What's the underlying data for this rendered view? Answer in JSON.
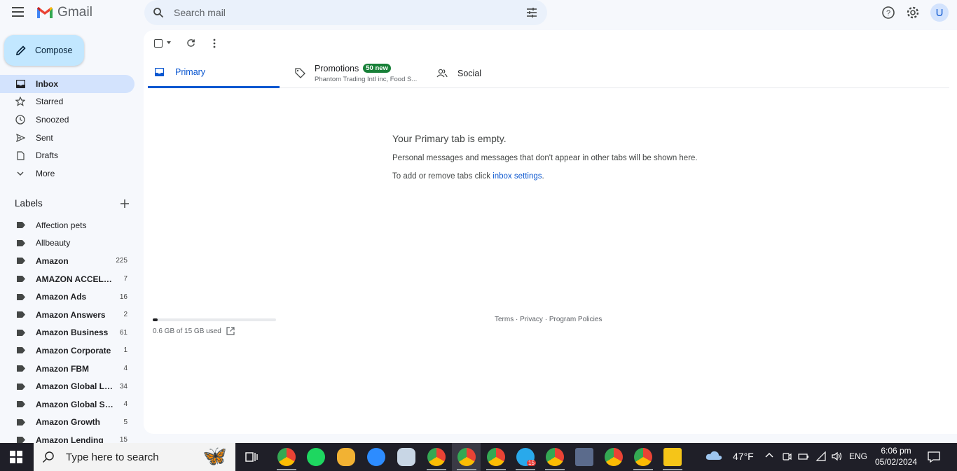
{
  "header": {
    "app_name": "Gmail",
    "search_placeholder": "Search mail",
    "avatar_initial": "U"
  },
  "sidebar": {
    "compose_label": "Compose",
    "items": [
      {
        "label": "Inbox",
        "icon": "inbox-icon",
        "active": true
      },
      {
        "label": "Starred",
        "icon": "star-icon"
      },
      {
        "label": "Snoozed",
        "icon": "clock-icon"
      },
      {
        "label": "Sent",
        "icon": "send-icon"
      },
      {
        "label": "Drafts",
        "icon": "draft-icon"
      },
      {
        "label": "More",
        "icon": "chevron-down-icon"
      }
    ],
    "labels_heading": "Labels",
    "labels": [
      {
        "name": "Affection pets",
        "count": "",
        "bold": false
      },
      {
        "name": "Allbeauty",
        "count": "",
        "bold": false
      },
      {
        "name": "Amazon",
        "count": "225",
        "bold": true
      },
      {
        "name": "AMAZON ACCELERATOR",
        "count": "7",
        "bold": true
      },
      {
        "name": "Amazon Ads",
        "count": "16",
        "bold": true
      },
      {
        "name": "Amazon Answers",
        "count": "2",
        "bold": true
      },
      {
        "name": "Amazon Business",
        "count": "61",
        "bold": true
      },
      {
        "name": "Amazon Corporate",
        "count": "1",
        "bold": true
      },
      {
        "name": "Amazon FBM",
        "count": "4",
        "bold": true
      },
      {
        "name": "Amazon Global Logistics",
        "count": "34",
        "bold": true
      },
      {
        "name": "Amazon Global Selling",
        "count": "4",
        "bold": true
      },
      {
        "name": "Amazon Growth",
        "count": "5",
        "bold": true
      },
      {
        "name": "Amazon Lending",
        "count": "15",
        "bold": true
      }
    ]
  },
  "tabs": {
    "primary": "Primary",
    "promotions": "Promotions",
    "promotions_badge": "50 new",
    "promotions_sub": "Phantom Trading Intl inc, Food S...",
    "social": "Social"
  },
  "empty": {
    "title": "Your Primary tab is empty.",
    "line1": "Personal messages and messages that don't appear in other tabs will be shown here.",
    "line2_prefix": "To add or remove tabs click ",
    "line2_link": "inbox settings",
    "line2_suffix": "."
  },
  "storage": {
    "text": "0.6 GB of 15 GB used",
    "fraction": 0.04
  },
  "footer": {
    "terms": "Terms",
    "privacy": "Privacy",
    "policies": "Program Policies",
    "sep": " · "
  },
  "taskbar": {
    "search_placeholder": "Type here to search",
    "weather": "47°F",
    "lang": "ENG",
    "time": "6:06 pm",
    "date": "05/02/2024",
    "telegram_badge": "15"
  },
  "colors": {
    "accent": "#0b57d0",
    "compose_bg": "#c2e7ff",
    "active_nav": "#d3e3fd",
    "badge_green": "#188038"
  }
}
